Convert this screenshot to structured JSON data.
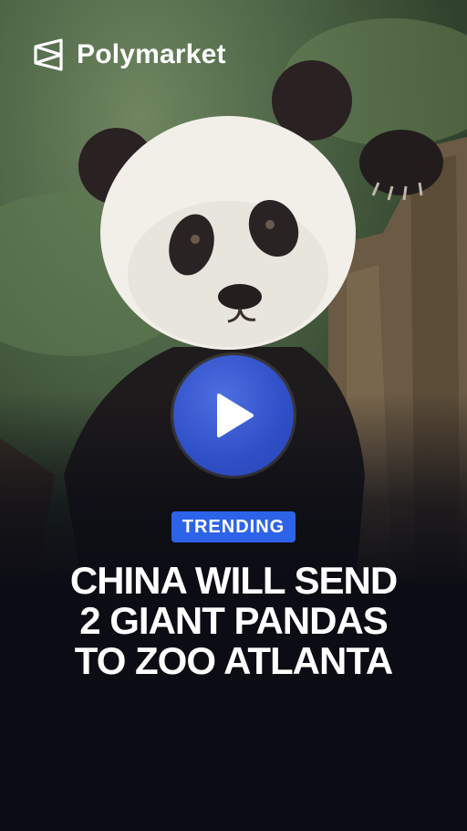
{
  "brand": {
    "name": "Polymarket",
    "logo_icon": "polymarket-logo-icon"
  },
  "media": {
    "subject": "panda-photo",
    "play_icon": "play-icon"
  },
  "badge": {
    "label": "TRENDING"
  },
  "headline": {
    "lines": [
      "CHINA WILL SEND",
      "2 GIANT PANDAS",
      "TO ZOO ATLANTA"
    ]
  },
  "colors": {
    "background": "#0b0c14",
    "badge": "#2d63e8",
    "play_button": "#2f4fc7",
    "text": "#ffffff"
  }
}
